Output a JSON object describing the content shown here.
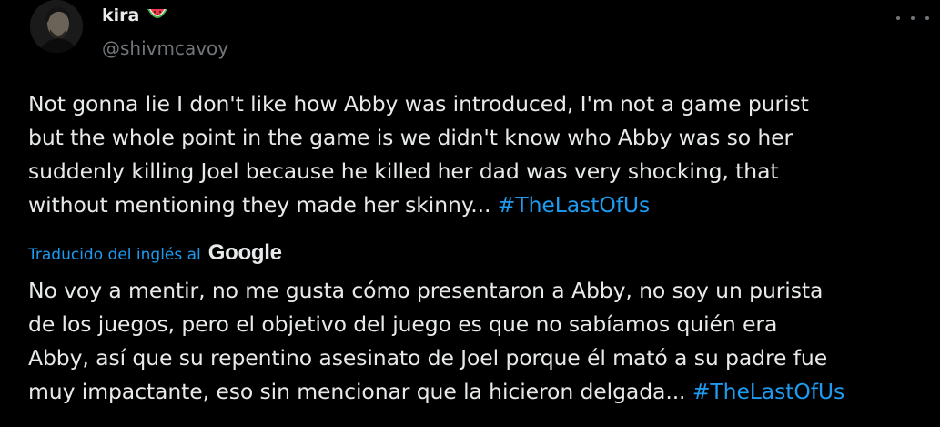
{
  "user": {
    "display_name": "kira",
    "emoji_icon": "watermelon-icon",
    "handle": "@shivmcavoy"
  },
  "menu": {
    "icon": "more-options-icon"
  },
  "tweet": {
    "original": {
      "lines": [
        "Not gonna lie I don't like how Abby was introduced, I'm not a game purist",
        "but the whole point in the game is we didn't know who Abby was so her",
        "suddenly killing Joel because he killed her dad was very shocking, that",
        "without mentioning they made her skinny... "
      ],
      "hashtag": "#TheLastOfUs"
    },
    "translation": {
      "label": "Traducido del inglés al",
      "provider": "Google",
      "lines": [
        "No voy a mentir, no me gusta cómo presentaron a Abby, no soy un purista",
        "de los juegos, pero el objetivo del juego es que no sabíamos quién era",
        "Abby, así que su repentino asesinato de Joel porque él mató a su padre fue",
        "muy impactante, eso sin mencionar que la hicieron delgada... "
      ],
      "hashtag": "#TheLastOfUs"
    }
  },
  "colors": {
    "background": "#000000",
    "text": "#e7e9ea",
    "secondary": "#71767b",
    "accent": "#1d9bf0"
  }
}
